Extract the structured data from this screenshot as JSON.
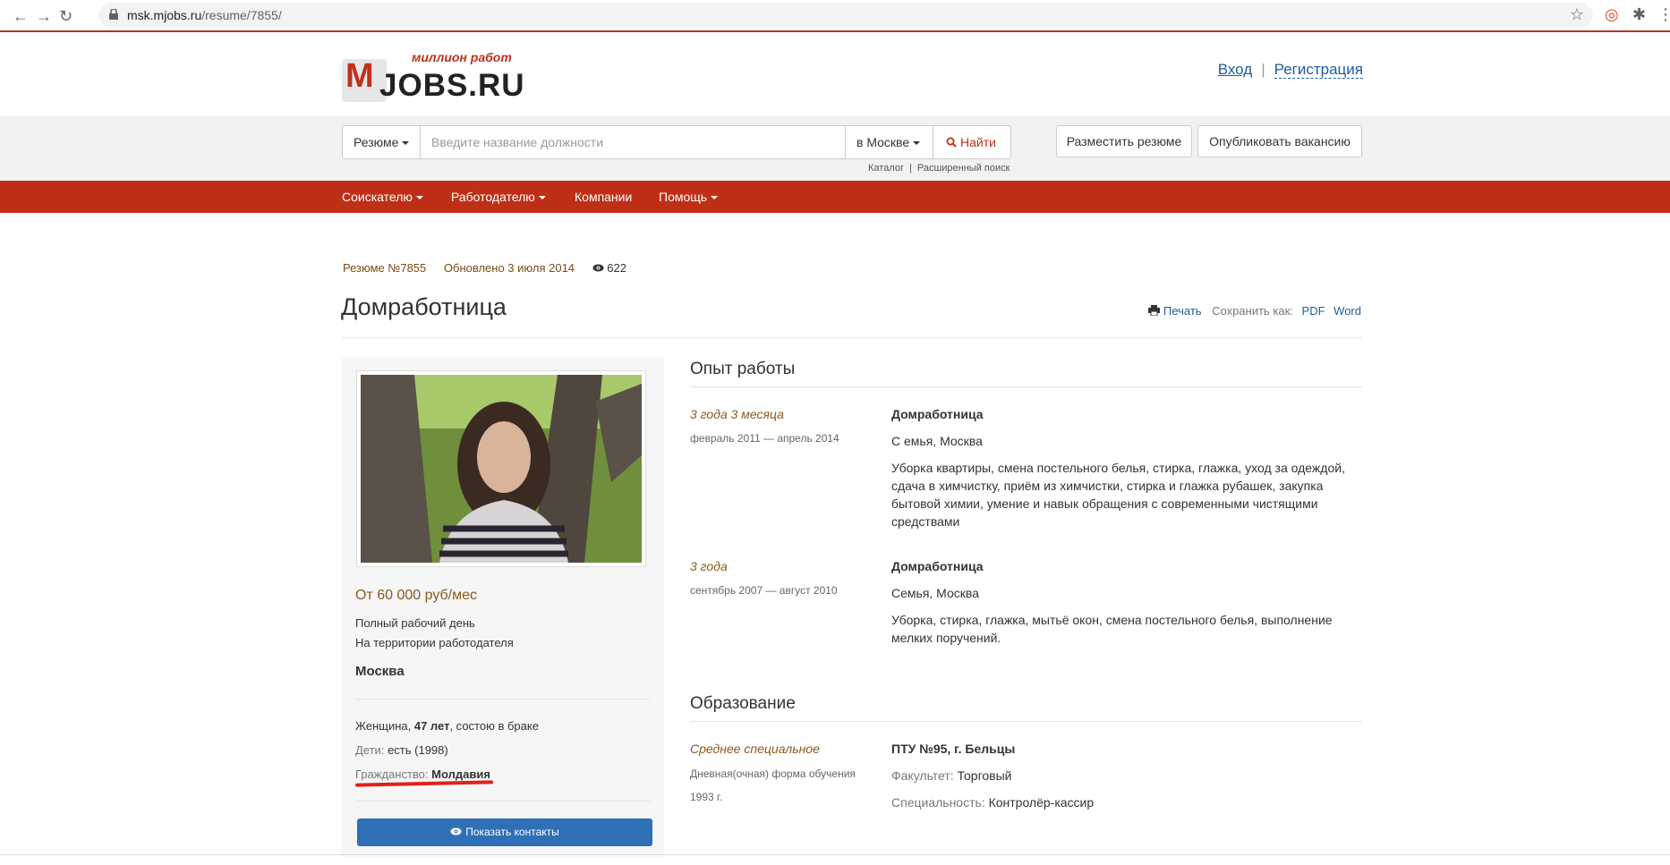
{
  "browser": {
    "url_host": "msk.mjobs.ru",
    "url_path": "/resume/7855/"
  },
  "header": {
    "logo_tagline": "миллион работ",
    "logo_m": "M",
    "logo_text": "JOBS.RU",
    "login": "Вход",
    "separator": "|",
    "register": "Регистрация"
  },
  "search": {
    "type_label": "Резюме",
    "query_placeholder": "Введите название должности",
    "city_label": "в Москве",
    "submit_label": "Найти",
    "catalog_link": "Каталог",
    "links_sep": "|",
    "advanced_link": "Расширенный поиск",
    "post_resume": "Разместить резюме",
    "post_vacancy": "Опубликовать вакансию"
  },
  "nav": {
    "items": [
      "Соискателю",
      "Работодателю",
      "Компании",
      "Помощь"
    ]
  },
  "resume": {
    "number": "Резюме №7855",
    "updated": "Обновлено 3 июля 2014",
    "views": "622",
    "title": "Домработница",
    "print": "Печать",
    "save_as": "Сохранить как:",
    "pdf": "PDF",
    "word": "Word"
  },
  "profile": {
    "salary": "От 60 000 руб/мес",
    "schedule": "Полный рабочий день",
    "location_type": "На территории работодателя",
    "city": "Москва",
    "personal_prefix": "Женщина,",
    "age": "47 лет",
    "personal_suffix": ", состою в браке",
    "children_label": "Дети:",
    "children_value": "есть (1998)",
    "citizenship_label": "Гражданство:",
    "citizenship_value": "Молдавия",
    "show_contacts": "Показать контакты"
  },
  "experience": {
    "heading": "Опыт работы",
    "jobs": [
      {
        "duration": "3 года 3 месяца",
        "dates": "февраль 2011 — апрель 2014",
        "position": "Домработница",
        "employer": "С емья, Москва",
        "description": "Уборка квартиры, смена постельного белья, стирка, глажка, уход за одеждой, сдача в химчистку, приём из химчистки, стирка и глажка рубашек, закупка бытовой химии, умение и навык обращения с современными чистящими средствами"
      },
      {
        "duration": "3 года",
        "dates": "сентябрь 2007 — август 2010",
        "position": "Домработница",
        "employer": "Семья, Москва",
        "description": "Уборка, стирка, глажка, мытьё окон, смена постельного белья, выполнение мелких поручений."
      }
    ]
  },
  "education": {
    "heading": "Образование",
    "level": "Среднее специальное",
    "form": "Дневная(очная) форма обучения",
    "year": "1993 г.",
    "institution": "ПТУ №95, г. Бельцы",
    "faculty_label": "Факультет:",
    "faculty_value": "Торговый",
    "specialty_label": "Специальность:",
    "specialty_value": "Контролёр-кассир"
  },
  "colors": {
    "brand_red": "#bf2f16",
    "link_blue": "#1f5c99",
    "accent_brown": "#8a5a1a",
    "button_blue": "#2f6fb6"
  }
}
